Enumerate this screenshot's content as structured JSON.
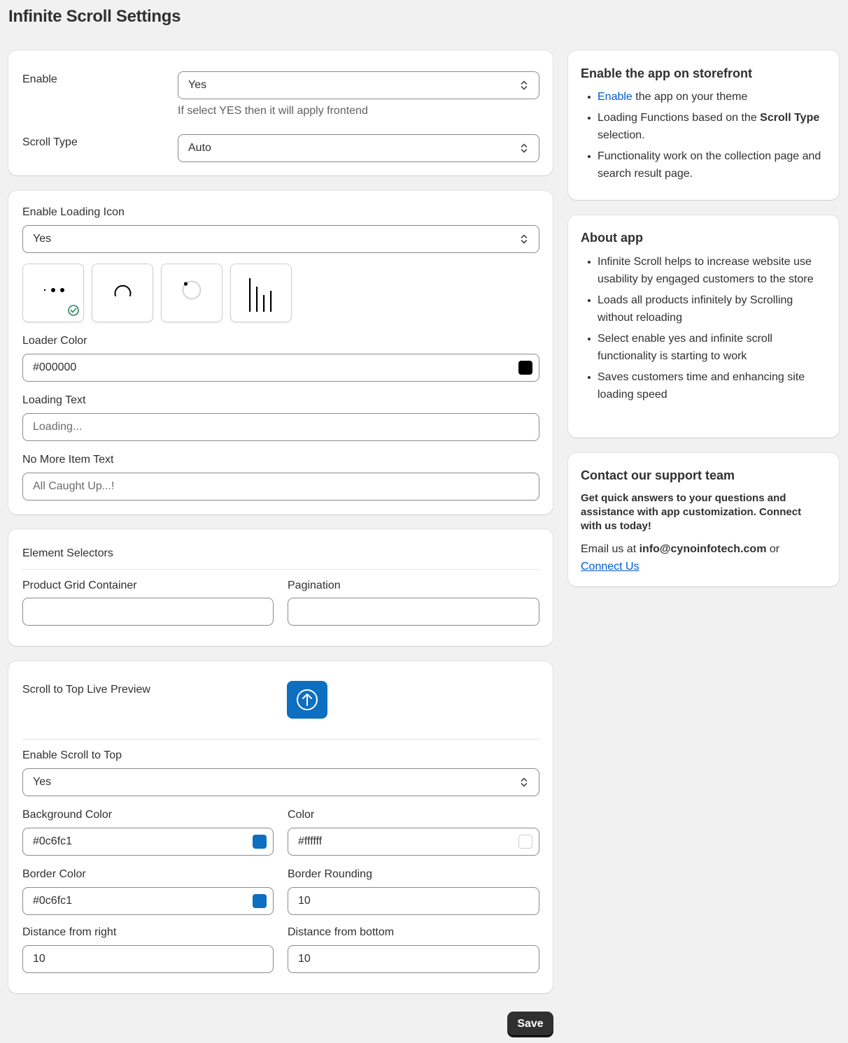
{
  "page": {
    "title": "Infinite Scroll Settings"
  },
  "general": {
    "enable_label": "Enable",
    "enable_value": "Yes",
    "enable_help": "If select YES then it will apply frontend",
    "scroll_type_label": "Scroll Type",
    "scroll_type_value": "Auto"
  },
  "loading": {
    "enable_icon_label": "Enable Loading Icon",
    "enable_icon_value": "Yes",
    "icons": [
      "dots-loader-icon",
      "arc-spinner-icon",
      "circle-dot-spinner-icon",
      "bars-loader-icon"
    ],
    "selected_icon": "dots-loader-icon",
    "loader_color_label": "Loader Color",
    "loader_color_value": "#000000",
    "loading_text_label": "Loading Text",
    "loading_text_placeholder": "Loading...",
    "no_more_label": "No More Item Text",
    "no_more_placeholder": "All Caught Up...!"
  },
  "selectors": {
    "heading": "Element Selectors",
    "product_grid_label": "Product Grid Container",
    "product_grid_value": "",
    "pagination_label": "Pagination",
    "pagination_value": ""
  },
  "scroll_top": {
    "preview_label": "Scroll to Top Live Preview",
    "enable_label": "Enable Scroll to Top",
    "enable_value": "Yes",
    "bg_color_label": "Background Color",
    "bg_color_value": "#0c6fc1",
    "color_label": "Color",
    "color_value": "#ffffff",
    "border_color_label": "Border Color",
    "border_color_value": "#0c6fc1",
    "border_rounding_label": "Border Rounding",
    "border_rounding_value": "10",
    "distance_right_label": "Distance from right",
    "distance_right_value": "10",
    "distance_bottom_label": "Distance from bottom",
    "distance_bottom_value": "10"
  },
  "storefront": {
    "title": "Enable the app on storefront",
    "item1_link": "Enable",
    "item1_rest": " the app on your theme",
    "item2_pre": "Loading Functions based on the ",
    "item2_bold": "Scroll Type",
    "item2_post": " selection.",
    "item3": "Functionality work on the collection page and search result page."
  },
  "about": {
    "title": "About app",
    "items": [
      "Infinite Scroll helps to increase website use usability by engaged customers to the store",
      "Loads all products infinitely by Scrolling without reloading",
      "Select enable yes and infinite scroll functionality is starting to work",
      "Saves customers time and enhancing site loading speed"
    ]
  },
  "support": {
    "title": "Contact our support team",
    "description": "Get quick answers to your questions and assistance with app customization. Connect with us today!",
    "email_prefix": "Email us at ",
    "email": "info@cynoinfotech.com",
    "or_text": " or",
    "connect_link": "Connect Us"
  },
  "actions": {
    "save_label": "Save"
  },
  "colors": {
    "accent": "#0c6fc1",
    "link": "#005bd3",
    "success": "#29845a",
    "primary_button": "#303030"
  }
}
